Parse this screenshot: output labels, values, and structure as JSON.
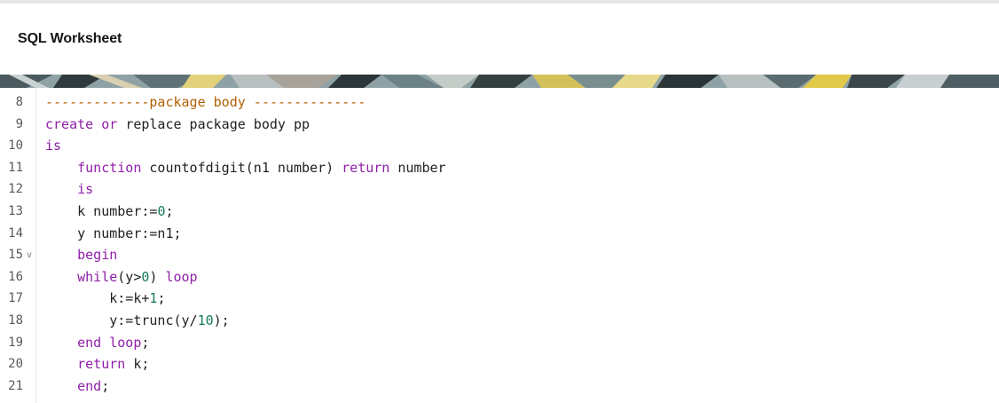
{
  "header": {
    "title": "SQL Worksheet"
  },
  "editor": {
    "lines": [
      {
        "number": "8",
        "tokens": [
          {
            "t": "-------------package body --------------",
            "k": "cm"
          }
        ]
      },
      {
        "number": "9",
        "tokens": [
          {
            "t": "create",
            "k": "kw"
          },
          {
            "t": " ",
            "k": "plain"
          },
          {
            "t": "or",
            "k": "kw"
          },
          {
            "t": " ",
            "k": "plain"
          },
          {
            "t": "replace",
            "k": "plain"
          },
          {
            "t": " package body pp",
            "k": "plain"
          }
        ]
      },
      {
        "number": "10",
        "tokens": [
          {
            "t": "is",
            "k": "kw"
          }
        ]
      },
      {
        "number": "11",
        "tokens": [
          {
            "t": "    ",
            "k": "plain"
          },
          {
            "t": "function",
            "k": "kw"
          },
          {
            "t": " countofdigit(n1 number) ",
            "k": "plain"
          },
          {
            "t": "return",
            "k": "kw"
          },
          {
            "t": " number",
            "k": "plain"
          }
        ]
      },
      {
        "number": "12",
        "tokens": [
          {
            "t": "    ",
            "k": "plain"
          },
          {
            "t": "is",
            "k": "kw"
          }
        ]
      },
      {
        "number": "13",
        "tokens": [
          {
            "t": "    k number:=",
            "k": "plain"
          },
          {
            "t": "0",
            "k": "num"
          },
          {
            "t": ";",
            "k": "plain"
          }
        ]
      },
      {
        "number": "14",
        "tokens": [
          {
            "t": "    y number:=n1;",
            "k": "plain"
          }
        ]
      },
      {
        "number": "15",
        "fold": true,
        "tokens": [
          {
            "t": "    ",
            "k": "plain"
          },
          {
            "t": "begin",
            "k": "kw"
          }
        ]
      },
      {
        "number": "16",
        "tokens": [
          {
            "t": "    ",
            "k": "plain"
          },
          {
            "t": "while",
            "k": "kw"
          },
          {
            "t": "(y>",
            "k": "plain"
          },
          {
            "t": "0",
            "k": "num"
          },
          {
            "t": ") ",
            "k": "plain"
          },
          {
            "t": "loop",
            "k": "kw"
          }
        ]
      },
      {
        "number": "17",
        "tokens": [
          {
            "t": "        k:=k+",
            "k": "plain"
          },
          {
            "t": "1",
            "k": "num"
          },
          {
            "t": ";",
            "k": "plain"
          }
        ]
      },
      {
        "number": "18",
        "tokens": [
          {
            "t": "        y:=trunc(y/",
            "k": "plain"
          },
          {
            "t": "10",
            "k": "num"
          },
          {
            "t": ");",
            "k": "plain"
          }
        ]
      },
      {
        "number": "19",
        "tokens": [
          {
            "t": "    ",
            "k": "plain"
          },
          {
            "t": "end",
            "k": "kw"
          },
          {
            "t": " ",
            "k": "plain"
          },
          {
            "t": "loop",
            "k": "kw"
          },
          {
            "t": ";",
            "k": "plain"
          }
        ]
      },
      {
        "number": "20",
        "tokens": [
          {
            "t": "    ",
            "k": "plain"
          },
          {
            "t": "return",
            "k": "kw"
          },
          {
            "t": " k;",
            "k": "plain"
          }
        ]
      },
      {
        "number": "21",
        "tokens": [
          {
            "t": "    ",
            "k": "plain"
          },
          {
            "t": "end",
            "k": "kw"
          },
          {
            "t": ";",
            "k": "plain"
          }
        ]
      }
    ],
    "fold_icon": "chevron-down-icon"
  },
  "colors": {
    "keyword": "#8f1fa8",
    "comment": "#b25f00",
    "number": "#157a5a",
    "text": "#1f1f1f"
  }
}
